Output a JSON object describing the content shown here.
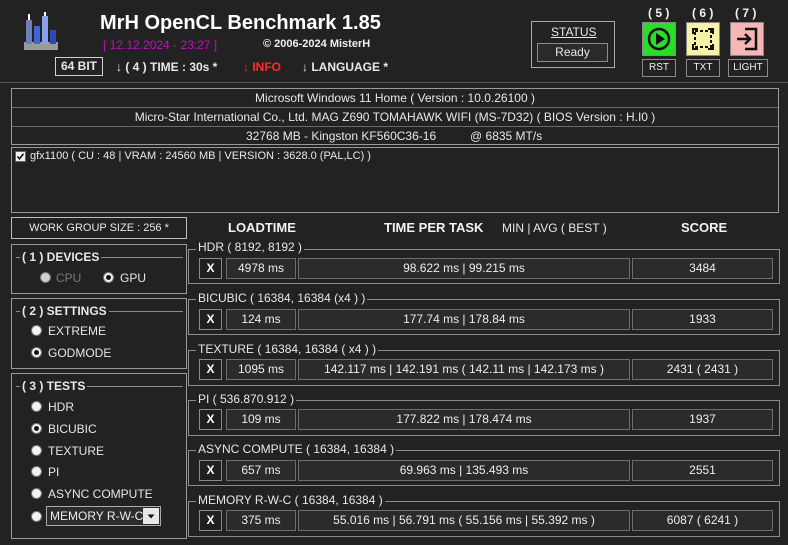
{
  "header": {
    "title": "MrH OpenCL Benchmark 1.85",
    "datetime": "[ 12.12.2024 - 23:27 ]",
    "copyright": "© 2006-2024 MisterH",
    "bitness": "64 BIT",
    "time_option": "↓ ( 4 ) TIME : 30s *",
    "info_option": "↓ INFO",
    "language_option": "↓ LANGUAGE *",
    "status_title": "STATUS",
    "status_value": "Ready",
    "buttons": [
      {
        "number": "( 5 )",
        "label": "RST",
        "icon": "play-icon",
        "color": "#2bdc2b"
      },
      {
        "number": "( 6 )",
        "label": "TXT",
        "icon": "crop-select-icon",
        "color": "#f7f2a6"
      },
      {
        "number": "( 7 )",
        "label": "LIGHT",
        "icon": "exit-icon",
        "color": "#f6b6b6"
      }
    ]
  },
  "system": {
    "os": "Microsoft Windows 11 Home ( Version : 10.0.26100 )",
    "board": "Micro-Star International Co., Ltd. MAG Z690 TOMAHAWK WIFI (MS-7D32) ( BIOS Version : H.I0 )",
    "memory": "32768 MB - Kingston KF560C36-16",
    "memory_speed": "@ 6835 MT/s"
  },
  "device": {
    "checked": true,
    "label": "gfx1100 ( CU : 48 | VRAM : 24560 MB | VERSION : 3628.0 (PAL,LC) )"
  },
  "work_group": "WORK GROUP SIZE : 256 *",
  "columns": {
    "loadtime": "LOADTIME",
    "time_per_task": "TIME PER TASK",
    "min_avg_best": "MIN | AVG ( BEST )",
    "score": "SCORE"
  },
  "devices": {
    "title": "( 1 ) DEVICES",
    "options": [
      {
        "label": "CPU",
        "selected": false,
        "disabled": true
      },
      {
        "label": "GPU",
        "selected": true,
        "disabled": false
      }
    ]
  },
  "settings": {
    "title": "( 2 ) SETTINGS",
    "options": [
      {
        "label": "EXTREME",
        "selected": false
      },
      {
        "label": "GODMODE",
        "selected": true
      }
    ]
  },
  "tests": {
    "title": "( 3 ) TESTS",
    "options": [
      {
        "label": "HDR",
        "selected": false
      },
      {
        "label": "BICUBIC",
        "selected": true
      },
      {
        "label": "TEXTURE",
        "selected": false
      },
      {
        "label": "PI",
        "selected": false
      },
      {
        "label": "ASYNC COMPUTE",
        "selected": false
      }
    ],
    "dropdown_value": "MEMORY R-W-C"
  },
  "results": [
    {
      "name": "HDR ( 8192, 8192 )",
      "x": "X",
      "load": "4978 ms",
      "time": "98.622 ms | 99.215 ms",
      "score": "3484"
    },
    {
      "name": "BICUBIC ( 16384, 16384 (x4 ) )",
      "x": "X",
      "load": "124 ms",
      "time": "177.74 ms | 178.84 ms",
      "score": "1933"
    },
    {
      "name": "TEXTURE ( 16384, 16384 ( x4 ) )",
      "x": "X",
      "load": "1095 ms",
      "time": "142.117 ms | 142.191 ms  ( 142.11 ms | 142.173 ms )",
      "score": "2431  ( 2431 )"
    },
    {
      "name": "PI ( 536.870.912 )",
      "x": "X",
      "load": "109 ms",
      "time": "177.822 ms | 178.474 ms",
      "score": "1937"
    },
    {
      "name": "ASYNC COMPUTE ( 16384, 16384 )",
      "x": "X",
      "load": "657 ms",
      "time": "69.963 ms | 135.493 ms",
      "score": "2551"
    },
    {
      "name": "MEMORY R-W-C ( 16384, 16384 )",
      "x": "X",
      "load": "375 ms",
      "time": "55.016 ms | 56.791 ms  ( 55.156 ms | 55.392 ms )",
      "score": "6087  ( 6241 )"
    }
  ]
}
